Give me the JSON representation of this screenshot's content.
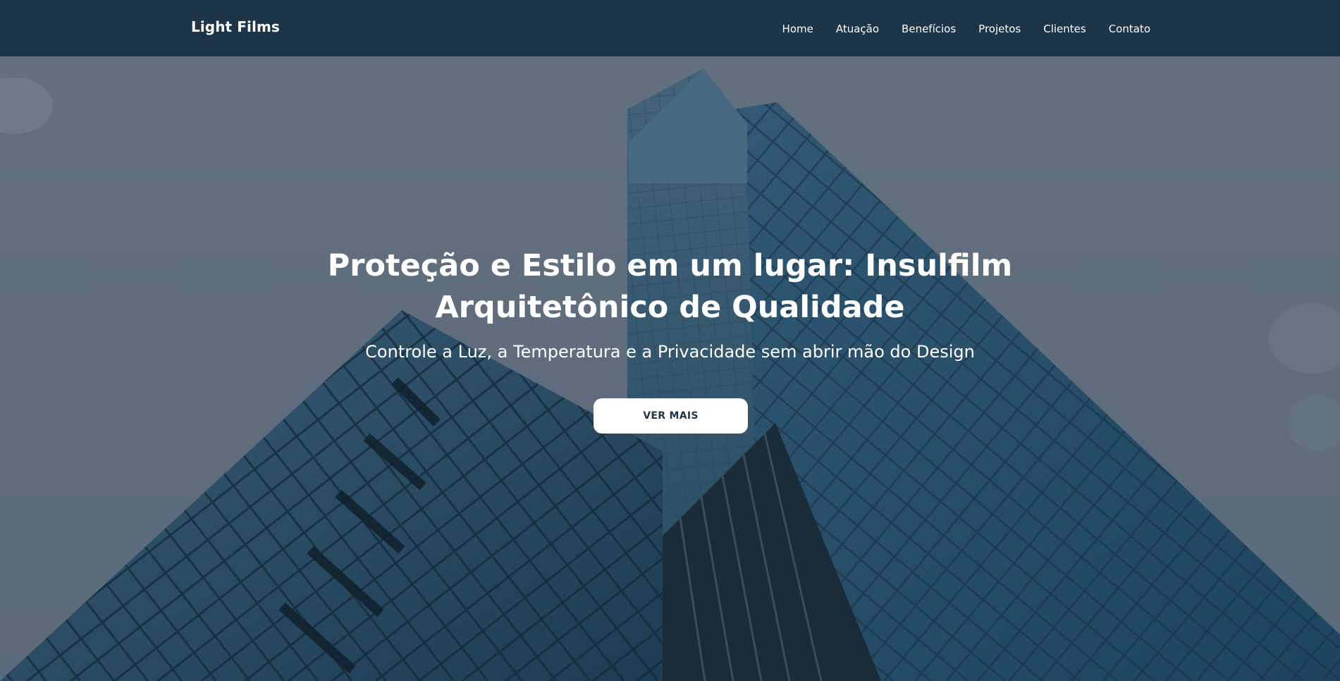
{
  "header": {
    "brand": "Light Films",
    "nav": [
      {
        "label": "Home"
      },
      {
        "label": "Atuação"
      },
      {
        "label": "Benefícios"
      },
      {
        "label": "Projetos"
      },
      {
        "label": "Clientes"
      },
      {
        "label": "Contato"
      }
    ]
  },
  "hero": {
    "title": "Proteção e Estilo em um lugar: Insulfilm Arquitetônico de Qualidade",
    "subtitle": "Controle a Luz, a Temperatura e a Privacidade sem abrir mão do Design",
    "button_label": "VER MAIS"
  },
  "colors": {
    "navbar_bg": "#1c3549",
    "button_bg": "#ffffff",
    "button_text": "#1c3549",
    "sky": "#727f8f",
    "glass": "#2e5a76"
  }
}
